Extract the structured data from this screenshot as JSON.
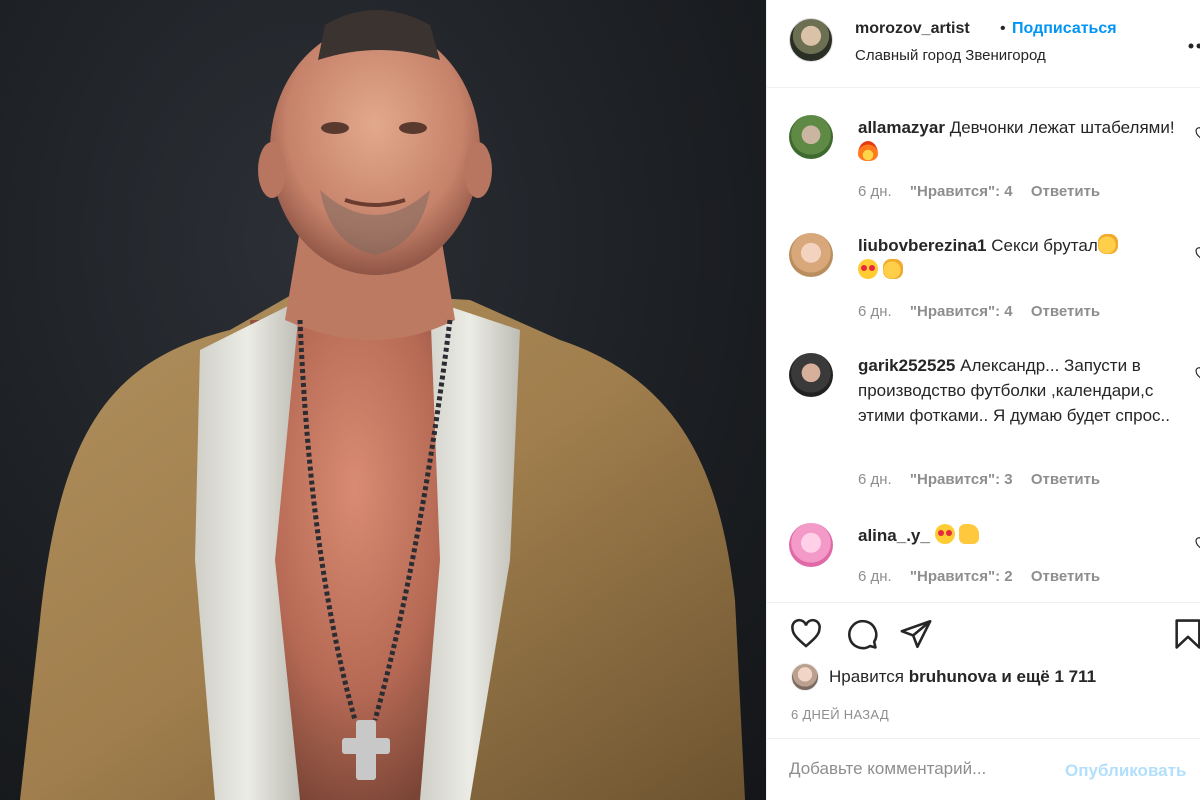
{
  "post": {
    "username": "morozov_artist",
    "separator": "•",
    "follow_label": "Подписаться",
    "location": "Славный город Звенигород"
  },
  "comments": [
    {
      "username": "allamazyar",
      "text": "Девчонки лежат штабелями!",
      "emoji": "fire",
      "age": "6 дн.",
      "likes": "\"Нравится\": 4",
      "reply": "Ответить"
    },
    {
      "username": "liubovberezina1",
      "text": "Секси брутал",
      "emoji": "clap",
      "age": "6 дн.",
      "likes": "\"Нравится\": 4",
      "reply": "Ответить"
    },
    {
      "username": "garik252525",
      "text": "Александр... Запусти в производство футболки ,календари,с этими фотками.. Я думаю будет спрос..",
      "emoji": "",
      "age": "6 дн.",
      "likes": "\"Нравится\": 3",
      "reply": "Ответить"
    },
    {
      "username": "alina_.y_",
      "text": "",
      "emoji": "heart-eyes, thumbs-up",
      "age": "6 дн.",
      "likes": "\"Нравится\": 2",
      "reply": "Ответить"
    }
  ],
  "likes": {
    "prefix": "Нравится",
    "user": "bruhunova",
    "suffix": "и ещё 1 711"
  },
  "time_ago": "6 ДНЕЙ НАЗАД",
  "add_comment": {
    "placeholder": "Добавьте комментарий...",
    "publish_label": "Опубликовать"
  },
  "colors": {
    "accent": "#0095f6",
    "publish_disabled": "#b2dffc",
    "muted": "#8e8e8e",
    "text": "#262626"
  }
}
